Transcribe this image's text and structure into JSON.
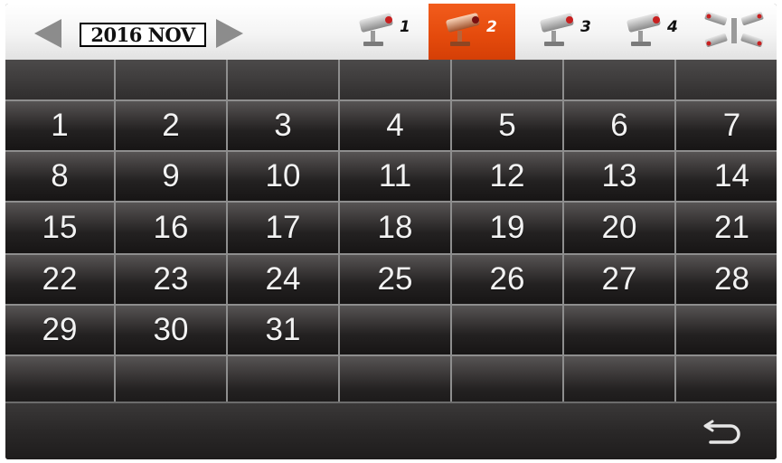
{
  "header": {
    "month_label": "2016 NOV",
    "cameras": [
      {
        "label": "1",
        "active": false,
        "icon": "cctv-camera-icon"
      },
      {
        "label": "2",
        "active": true,
        "icon": "cctv-camera-icon"
      },
      {
        "label": "3",
        "active": false,
        "icon": "cctv-camera-icon"
      },
      {
        "label": "4",
        "active": false,
        "icon": "cctv-camera-icon"
      },
      {
        "label": "",
        "active": false,
        "icon": "multi-camera-icon"
      }
    ],
    "active_color": "#e8500f"
  },
  "calendar": {
    "days": [
      "1",
      "2",
      "3",
      "4",
      "5",
      "6",
      "7",
      "8",
      "9",
      "10",
      "11",
      "12",
      "13",
      "14",
      "15",
      "16",
      "17",
      "18",
      "19",
      "20",
      "21",
      "22",
      "23",
      "24",
      "25",
      "26",
      "27",
      "28",
      "29",
      "30",
      "31"
    ]
  },
  "footer": {
    "back_icon": "back-return-icon"
  }
}
